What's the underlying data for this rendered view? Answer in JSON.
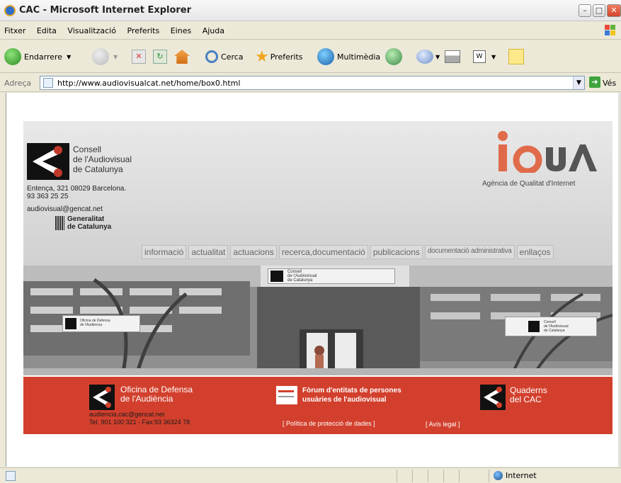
{
  "window": {
    "title": "CAC - Microsoft Internet Explorer"
  },
  "menu": [
    "Fitxer",
    "Edita",
    "Visualització",
    "Preferits",
    "Eines",
    "Ajuda"
  ],
  "toolbar": {
    "back": "Endarrere",
    "search": "Cerca",
    "favorites": "Preferits",
    "media": "Multimèdia"
  },
  "address": {
    "label": "Adreça",
    "url": "http://www.audiovisualcat.net/home/box0.html",
    "go": "Vés"
  },
  "status": {
    "zone": "Internet"
  },
  "site": {
    "org_name": [
      "Consell",
      "de l'Audiovisual",
      "de Catalunya"
    ],
    "address_lines": [
      "Entença, 321 08029 Barcelona.",
      "93 363 25 25"
    ],
    "email": "audiovisual@gencat.net",
    "generalitat": [
      "Generalitat",
      "de Catalunya"
    ],
    "iqua_subtitle": "Agència de Qualitat d'Internet",
    "nav": [
      "informació",
      "actualitat",
      "actuacions",
      "recerca,documentació",
      "publicacions",
      "documentació administrativa",
      "enllaços"
    ],
    "photo_sign_main": [
      "Consell",
      "de l'Audiovisual",
      "de Catalunya"
    ],
    "photo_sign_left": [
      "Oficina de Defensa",
      "de l'Audiència"
    ],
    "photo_sign_right": [
      "Consell",
      "de l'Audiovisual",
      "de Catalunya"
    ],
    "footer": {
      "oda_title": [
        "Oficina de Defensa",
        "de l'Audiència"
      ],
      "oda_email": "audiencia.cac@gencat.net",
      "oda_phone": "Tel. 901 100 321 - Fax:93 36324 78",
      "forum": [
        "Fòrum d'entitats de persones",
        "usuàries de l'audiovisual"
      ],
      "quaderns": [
        "Quaderns",
        "del CAC"
      ],
      "privacy": "[ Política de protecció de dades ]",
      "legal": "[ Avís legal ]"
    }
  }
}
